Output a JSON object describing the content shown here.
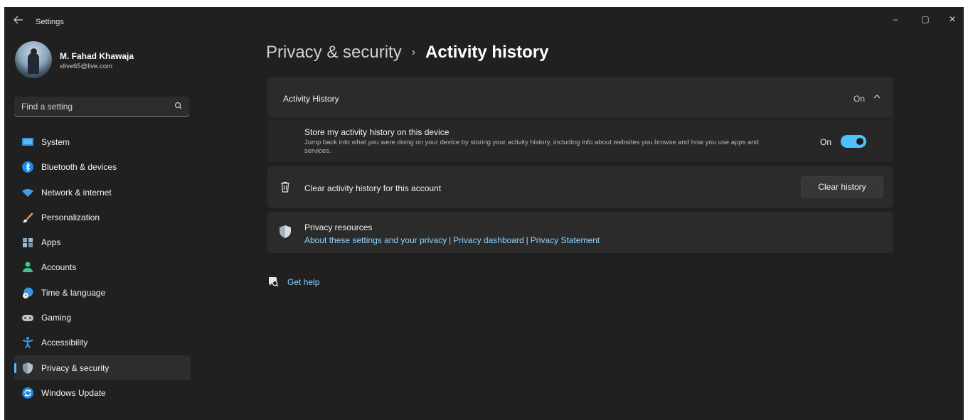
{
  "window": {
    "title": "Settings",
    "controls": {
      "minimize": "–",
      "maximize": "▢",
      "close": "✕"
    }
  },
  "profile": {
    "name": "M. Fahad Khawaja",
    "email": "xlive65@live.com"
  },
  "search": {
    "placeholder": "Find a setting"
  },
  "nav": {
    "items": [
      {
        "label": "System",
        "icon": "monitor-icon",
        "active": false
      },
      {
        "label": "Bluetooth & devices",
        "icon": "bluetooth-icon",
        "active": false
      },
      {
        "label": "Network & internet",
        "icon": "wifi-icon",
        "active": false
      },
      {
        "label": "Personalization",
        "icon": "brush-icon",
        "active": false
      },
      {
        "label": "Apps",
        "icon": "apps-icon",
        "active": false
      },
      {
        "label": "Accounts",
        "icon": "person-icon",
        "active": false
      },
      {
        "label": "Time & language",
        "icon": "globe-clock-icon",
        "active": false
      },
      {
        "label": "Gaming",
        "icon": "gamepad-icon",
        "active": false
      },
      {
        "label": "Accessibility",
        "icon": "accessibility-icon",
        "active": false
      },
      {
        "label": "Privacy & security",
        "icon": "shield-icon",
        "active": true
      },
      {
        "label": "Windows Update",
        "icon": "update-icon",
        "active": false
      }
    ]
  },
  "breadcrumb": {
    "parent": "Privacy & security",
    "separator": "›",
    "current": "Activity history"
  },
  "activity": {
    "header": {
      "title": "Activity History",
      "state": "On"
    },
    "store": {
      "title": "Store my activity history on this device",
      "description": "Jump back into what you were doing on your device by storing your activity history, including info about websites you browse and how you use apps and services.",
      "state": "On",
      "enabled": true
    },
    "clear": {
      "label": "Clear activity history for this account",
      "button": "Clear history"
    },
    "resources": {
      "title": "Privacy resources",
      "links": [
        "About these settings and your privacy",
        "Privacy dashboard",
        "Privacy Statement"
      ],
      "separator": "|"
    }
  },
  "help": {
    "label": "Get help"
  },
  "colors": {
    "accent": "#4cc2ff",
    "link": "#8fd3ff",
    "background": "#202020",
    "card": "#2b2b2b"
  }
}
